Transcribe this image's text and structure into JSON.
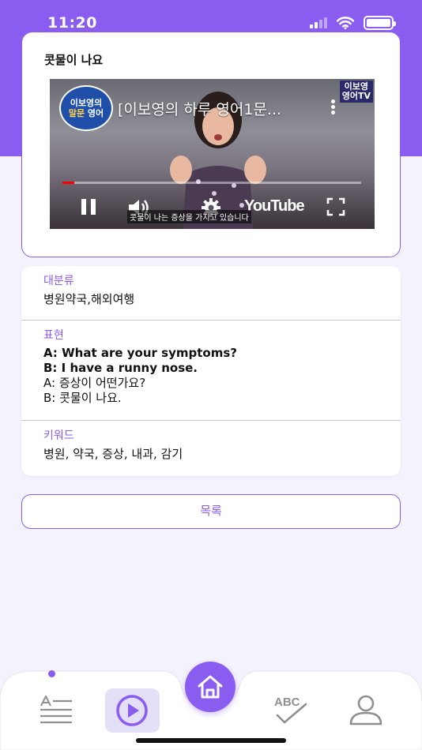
{
  "status_bar": {
    "time": "11:20"
  },
  "video": {
    "title": "콧물이 나요",
    "embed_title": "[이보영의 하루 영어1문...",
    "channel_badge_line1": "이보영의",
    "channel_badge_line2a": "말문",
    "channel_badge_line2b": " 영어",
    "channel_tag_line1": "이보영",
    "channel_tag_line2": "영어TV",
    "caption": "콧물이 나는 증상을 가지고 있습니다",
    "youtube_label": "YouTube",
    "progress": 0.04
  },
  "info": {
    "category_label": "대분류",
    "category_value": "병원약국,해외여행",
    "expression_label": "표현",
    "expression_en_a": "A: What are your symptoms?",
    "expression_en_b": "B: I have a runny nose.",
    "expression_ko_a": "A: 증상이 어떤가요?",
    "expression_ko_b": "B: 콧물이 나요.",
    "keyword_label": "키워드",
    "keyword_value": "병원, 약국, 증상, 내과, 감기"
  },
  "list_button_label": "목록",
  "colors": {
    "accent": "#8a5cf0",
    "tab_active_bg": "#e3dff7",
    "icon_gray": "#8e8e93"
  },
  "tabs": [
    {
      "icon": "text-lines-icon",
      "active": false
    },
    {
      "icon": "play-circle-icon",
      "active": true
    },
    {
      "icon": "home-icon",
      "active": false
    },
    {
      "icon": "abc-check-icon",
      "active": false
    },
    {
      "icon": "person-icon",
      "active": false
    }
  ]
}
